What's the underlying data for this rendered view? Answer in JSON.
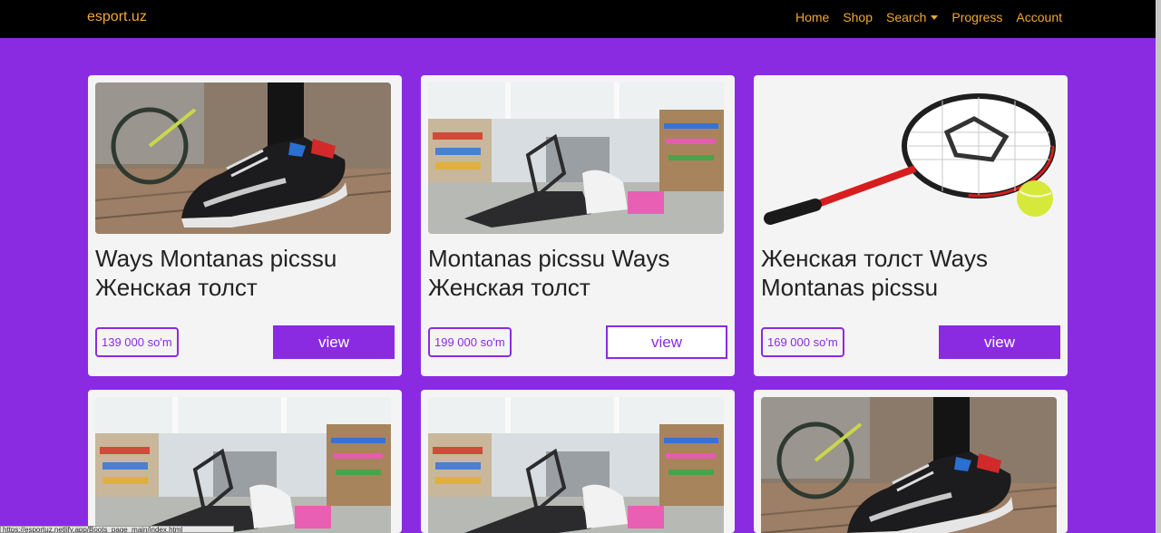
{
  "navbar": {
    "brand": "esport.uz",
    "links": [
      "Home",
      "Shop",
      "Search",
      "Progress",
      "Account"
    ]
  },
  "colors": {
    "accent": "#8a2be2",
    "nav_text": "#f0a830",
    "card_bg": "#f4f4f4"
  },
  "products": [
    {
      "image": "sneaker-photo",
      "title": "Ways Montanas picssu Женская толст",
      "price": "139 000 so'm",
      "button": "view"
    },
    {
      "image": "store-interior-photo",
      "title": "Montanas picssu Ways Женская толст",
      "price": "199 000 so'm",
      "button": "view"
    },
    {
      "image": "tennis-racket-photo",
      "title": "Женская толст Ways Montanas picssu",
      "price": "169 000 so'm",
      "button": "view"
    },
    {
      "image": "store-interior-photo"
    },
    {
      "image": "store-interior-photo"
    },
    {
      "image": "sneaker-photo"
    }
  ],
  "status_bar": {
    "url": "https://esportuz.netlify.app/Boots_page_main/index.html"
  }
}
